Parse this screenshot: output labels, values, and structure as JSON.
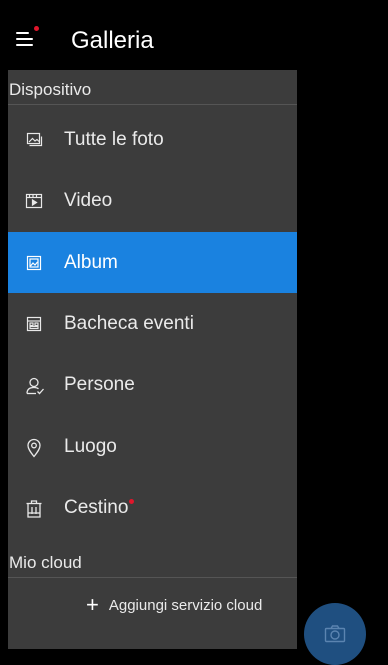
{
  "app": {
    "title": "Galleria"
  },
  "drawer": {
    "sections": {
      "device": "Dispositivo",
      "cloud": "Mio cloud"
    },
    "items": [
      {
        "label": "Tutte le foto",
        "icon": "photos-icon"
      },
      {
        "label": "Video",
        "icon": "video-icon"
      },
      {
        "label": "Album",
        "icon": "album-icon",
        "active": true
      },
      {
        "label": "Bacheca eventi",
        "icon": "event-board-icon"
      },
      {
        "label": "Persone",
        "icon": "people-icon"
      },
      {
        "label": "Luogo",
        "icon": "location-icon"
      },
      {
        "label": "Cestino",
        "icon": "trash-icon",
        "badge": true
      }
    ],
    "add_cloud_label": "Aggiungi servizio cloud"
  },
  "colors": {
    "accent": "#1a82e0",
    "badge": "#e0162b",
    "drawer_bg": "#3c3c3c",
    "fab_bg": "#1f4f80"
  }
}
